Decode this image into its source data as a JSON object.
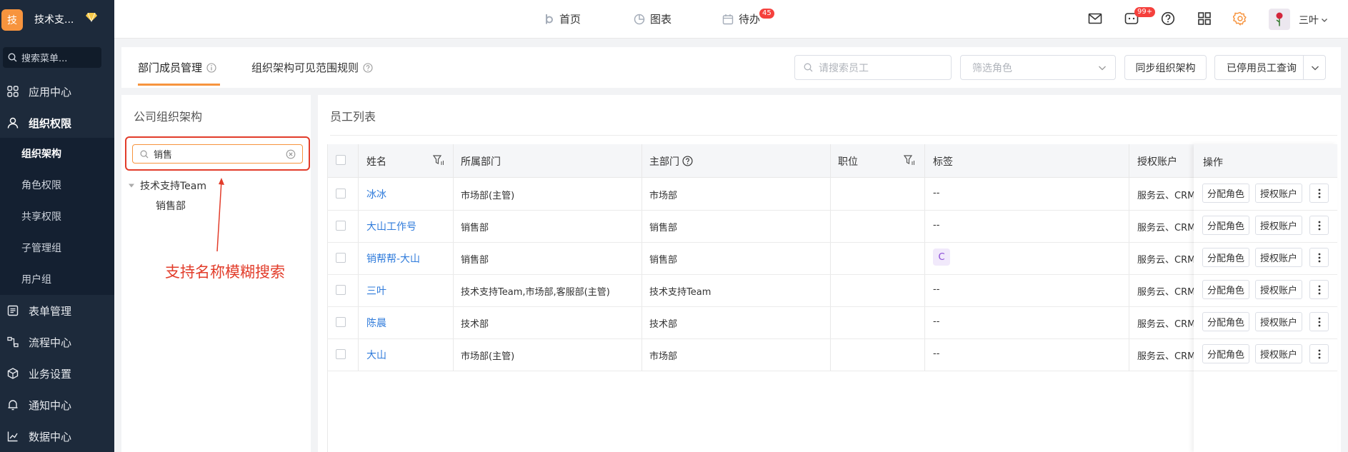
{
  "sidebar": {
    "logo_char": "技",
    "org_name": "技术支...",
    "search_placeholder": "搜索菜单...",
    "menu": [
      {
        "label": "应用中心",
        "icon": "grid-icon"
      },
      {
        "label": "组织权限",
        "icon": "user-icon",
        "active": true
      },
      {
        "label": "表单管理",
        "icon": "form-icon"
      },
      {
        "label": "流程中心",
        "icon": "flow-icon"
      },
      {
        "label": "业务设置",
        "icon": "cube-icon"
      },
      {
        "label": "通知中心",
        "icon": "bell-icon"
      },
      {
        "label": "数据中心",
        "icon": "chart-icon"
      }
    ],
    "submenu": [
      {
        "label": "组织架构",
        "active": true
      },
      {
        "label": "角色权限"
      },
      {
        "label": "共享权限"
      },
      {
        "label": "子管理组"
      },
      {
        "label": "用户组"
      }
    ]
  },
  "topbar": {
    "nav": [
      {
        "label": "首页",
        "icon": "home-icon"
      },
      {
        "label": "图表",
        "icon": "pie-icon"
      },
      {
        "label": "待办",
        "icon": "calendar-icon",
        "badge": "45"
      }
    ],
    "message_badge": "99+",
    "user_name": "三叶"
  },
  "tabs": [
    {
      "label": "部门成员管理",
      "active": true
    },
    {
      "label": "组织架构可见范围规则"
    }
  ],
  "toolbar": {
    "employee_search_placeholder": "请搜索员工",
    "role_filter_placeholder": "筛选角色",
    "sync_button": "同步组织架构",
    "disabled_query_button": "已停用员工查询"
  },
  "org_panel": {
    "title": "公司组织架构",
    "search_value": "销售",
    "tree": [
      {
        "label": "技术支持Team",
        "children": [
          {
            "label": "销售部"
          }
        ]
      }
    ],
    "annotation": "支持名称模糊搜索"
  },
  "employee_panel": {
    "title": "员工列表",
    "columns": [
      "姓名",
      "所属部门",
      "主部门",
      "职位",
      "标签",
      "授权账户",
      "操作"
    ],
    "rows": [
      {
        "name": "冰冰",
        "dept": "市场部(主管)",
        "main_dept": "市场部",
        "position": "",
        "tag": "--",
        "accounts": "服务云、CRM"
      },
      {
        "name": "大山工作号",
        "dept": "销售部",
        "main_dept": "销售部",
        "position": "",
        "tag": "--",
        "accounts": "服务云、CRM"
      },
      {
        "name": "销帮帮-大山",
        "dept": "销售部",
        "main_dept": "销售部",
        "position": "",
        "tag": "C",
        "accounts": "服务云、CRM"
      },
      {
        "name": "三叶",
        "dept": "技术支持Team,市场部,客服部(主管)",
        "main_dept": "技术支持Team",
        "position": "",
        "tag": "--",
        "accounts": "服务云、CRM"
      },
      {
        "name": "陈晨",
        "dept": "技术部",
        "main_dept": "技术部",
        "position": "",
        "tag": "--",
        "accounts": "服务云、CRM"
      },
      {
        "name": "大山",
        "dept": "市场部(主管)",
        "main_dept": "市场部",
        "position": "",
        "tag": "--",
        "accounts": "服务云、CRM"
      }
    ],
    "row_actions": {
      "assign_role": "分配角色",
      "authorize_account": "授权账户"
    }
  },
  "colors": {
    "sidebar_bg": "#1d2a3b",
    "accent": "#f7943e",
    "annotation": "#e23c2a",
    "link": "#2f7bdb",
    "badge": "#f5403c"
  }
}
